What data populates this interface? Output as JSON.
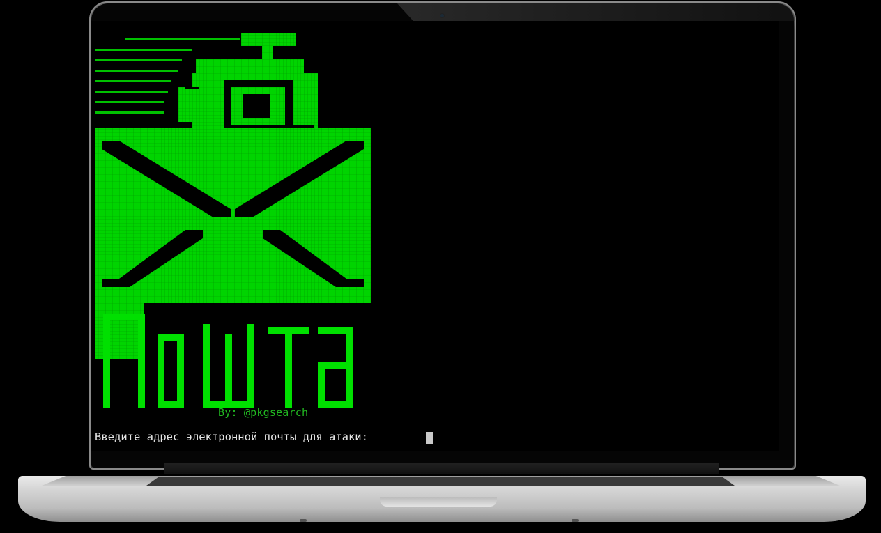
{
  "terminal": {
    "banner_text": "Почта",
    "byline": "By: @pkgsearch",
    "prompt": "Введите адрес электронной почты для атаки: ",
    "input_value": ""
  },
  "colors": {
    "terminal_bg": "#000000",
    "accent_green": "#00e000",
    "text": "#e6e6e6",
    "byline_green": "#21b821"
  },
  "icons": {
    "logo": "email-envelope-at-icon"
  }
}
